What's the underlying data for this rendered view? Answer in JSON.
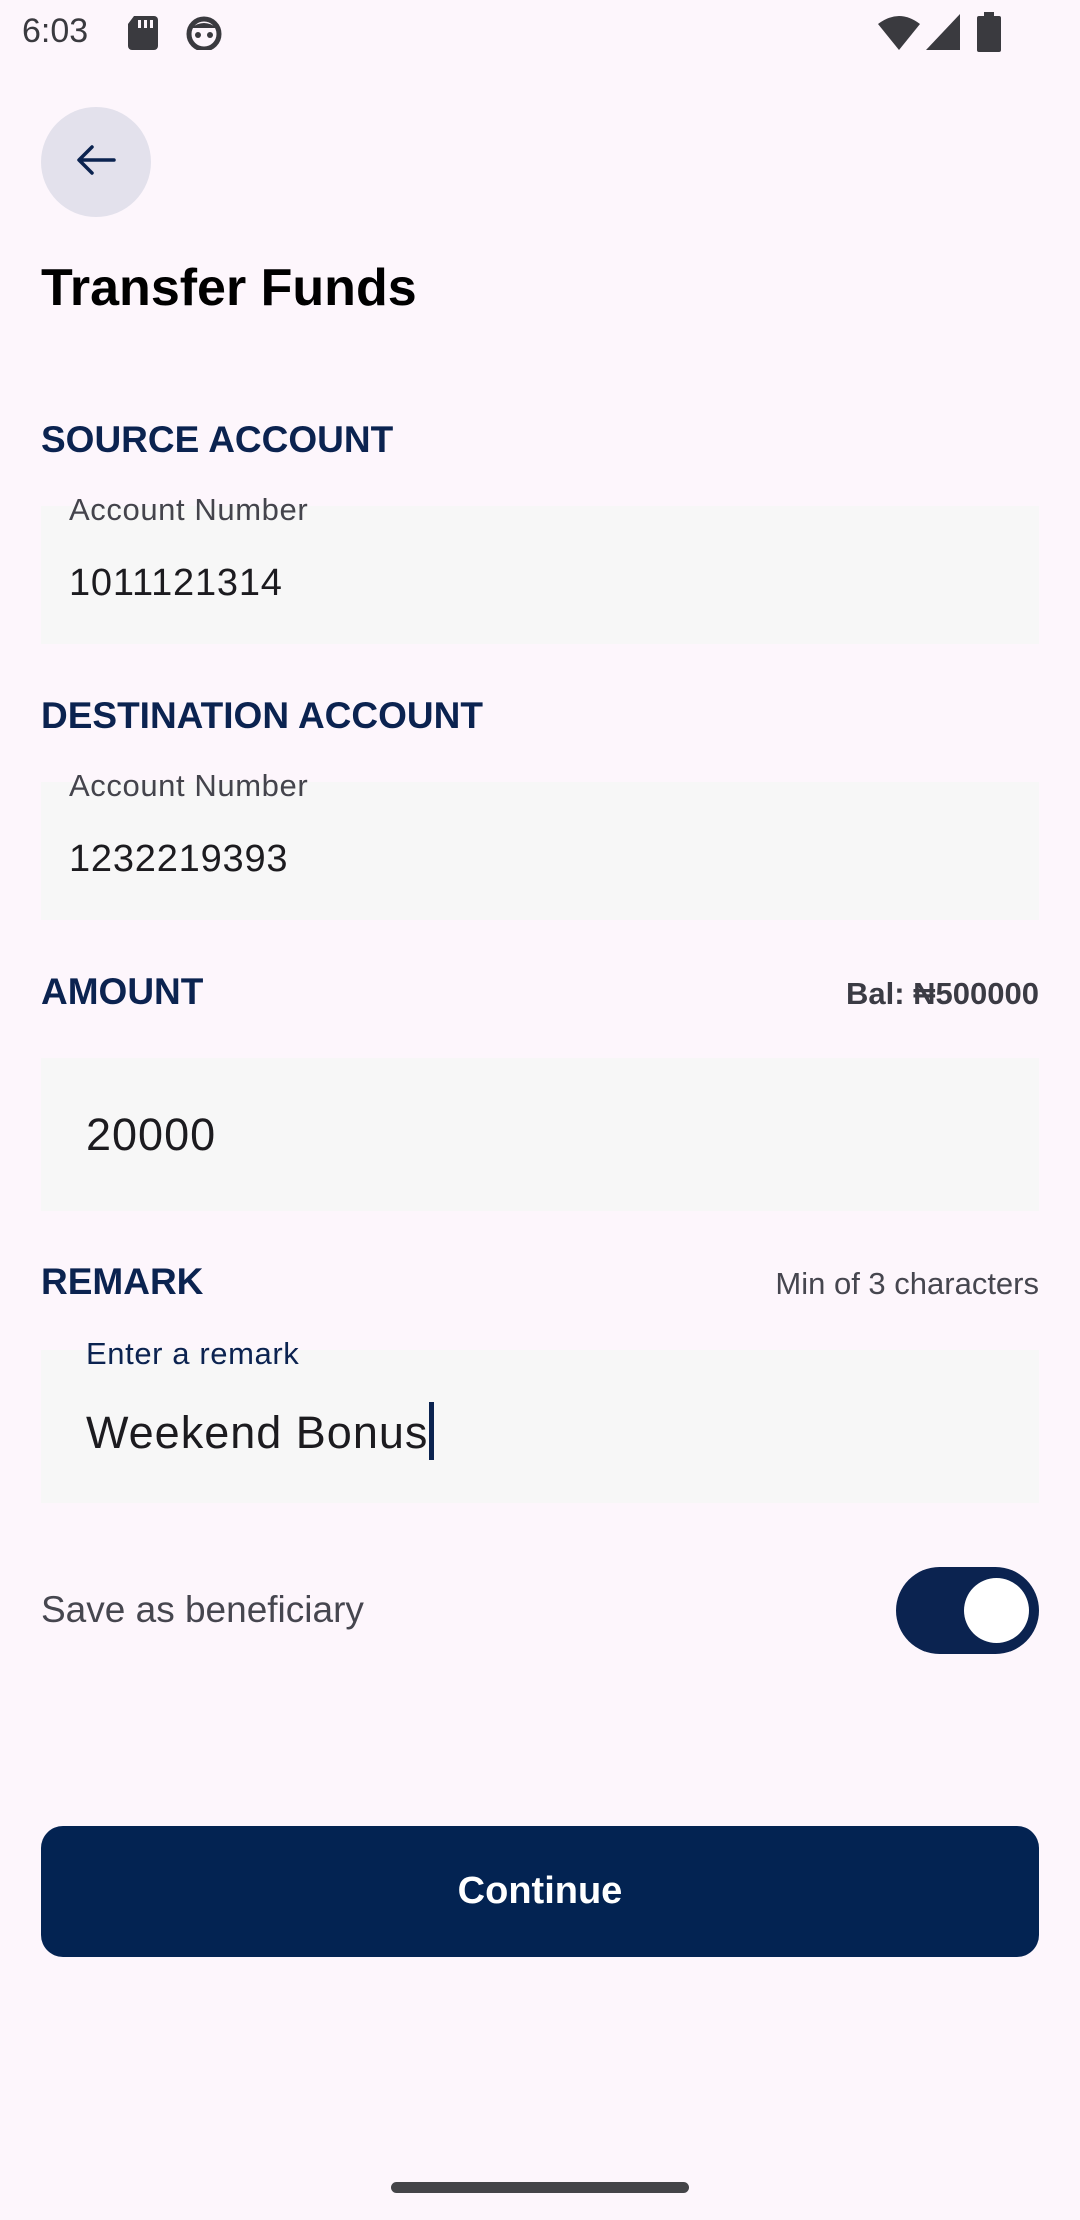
{
  "status_bar": {
    "time": "6:03",
    "icons": [
      "sd-card-icon",
      "android-face-icon",
      "wifi-icon",
      "signal-icon",
      "battery-icon"
    ]
  },
  "header": {
    "back_icon": "arrow-left-icon",
    "title": "Transfer Funds"
  },
  "source": {
    "section_label": "SOURCE ACCOUNT",
    "field_label": "Account Number",
    "value": "1011121314"
  },
  "destination": {
    "section_label": "DESTINATION ACCOUNT",
    "field_label": "Account Number",
    "value": "1232219393"
  },
  "amount": {
    "section_label": "AMOUNT",
    "balance": "Bal: ₦500000",
    "value": "20000"
  },
  "remark": {
    "section_label": "REMARK",
    "hint": "Min of 3 characters",
    "field_label": "Enter a remark",
    "value": "Weekend Bonus"
  },
  "beneficiary": {
    "label": "Save as beneficiary",
    "enabled": true
  },
  "actions": {
    "continue_label": "Continue"
  },
  "colors": {
    "background": "#fdf6fc",
    "primary": "#032352",
    "field_bg": "#f7f7f7",
    "back_button_bg": "#e3e1ec"
  }
}
